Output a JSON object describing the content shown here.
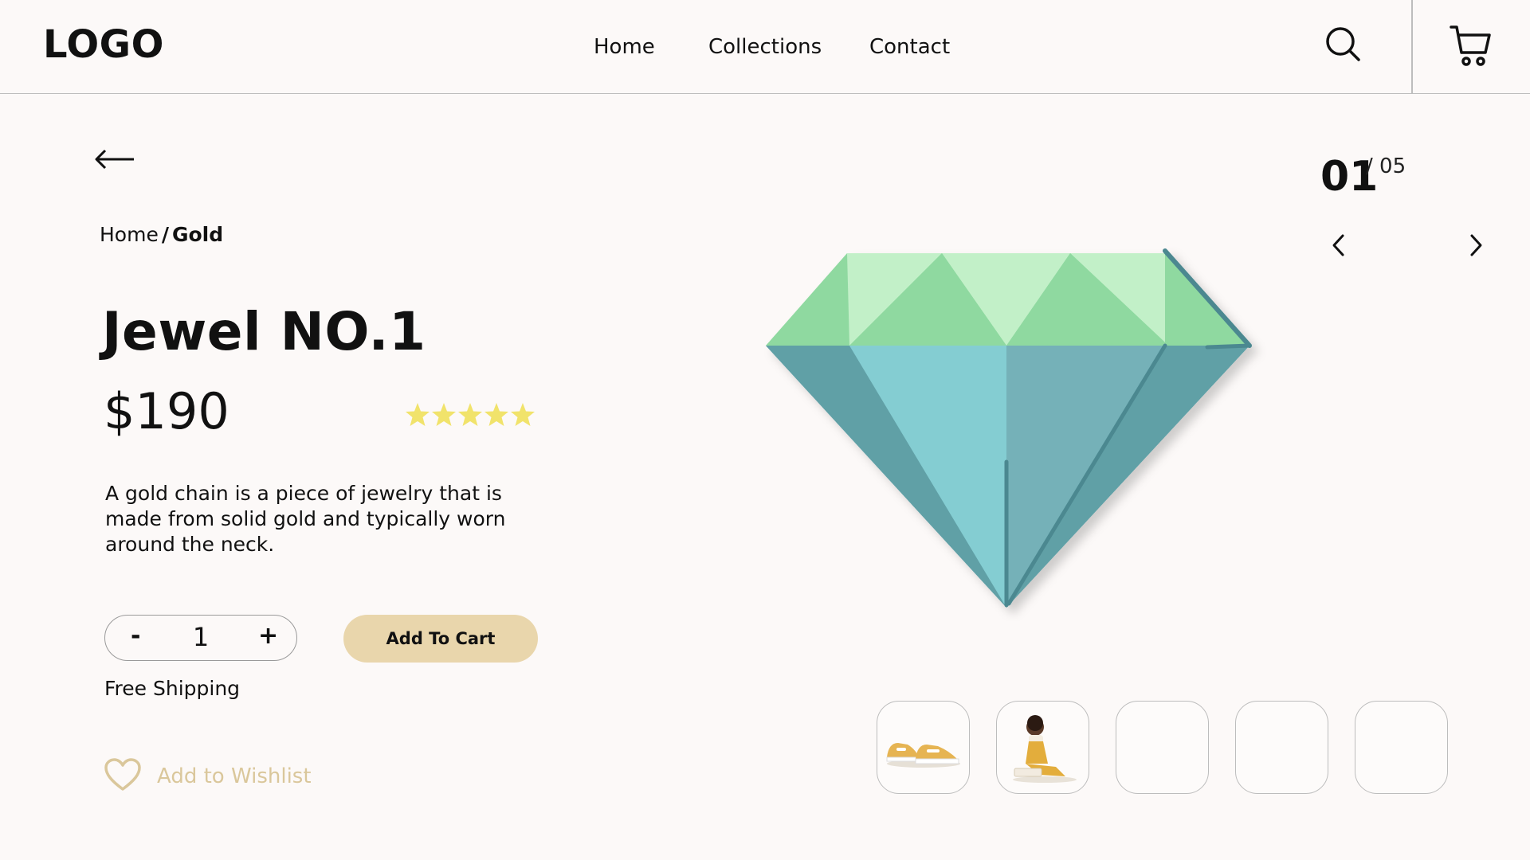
{
  "header": {
    "logo": "LOGO",
    "nav": [
      {
        "label": "Home"
      },
      {
        "label": "Collections"
      },
      {
        "label": "Contact"
      }
    ]
  },
  "slider": {
    "current": "01",
    "total": "/ 05"
  },
  "breadcrumb": {
    "home": "Home",
    "separator": "/",
    "current": "Gold"
  },
  "product": {
    "title": "Jewel NO.1",
    "price": "$190",
    "rating": 5,
    "description": "A gold chain is a piece of jewelry that is made from solid gold and typically worn around the neck.",
    "quantity": "1",
    "minus_label": "-",
    "plus_label": "+",
    "add_to_cart": "Add To Cart",
    "shipping": "Free Shipping",
    "wishlist": "Add to Wishlist"
  },
  "colors": {
    "accent": "#e9d6ac",
    "wishlist": "#dac79b",
    "star": "#f1e36b",
    "background": "#fcf9f8"
  },
  "icons": {
    "search": "search-icon",
    "cart": "cart-icon",
    "back": "arrow-left-icon",
    "prev": "chevron-left-icon",
    "next": "chevron-right-icon",
    "wishlist": "heart-icon"
  }
}
